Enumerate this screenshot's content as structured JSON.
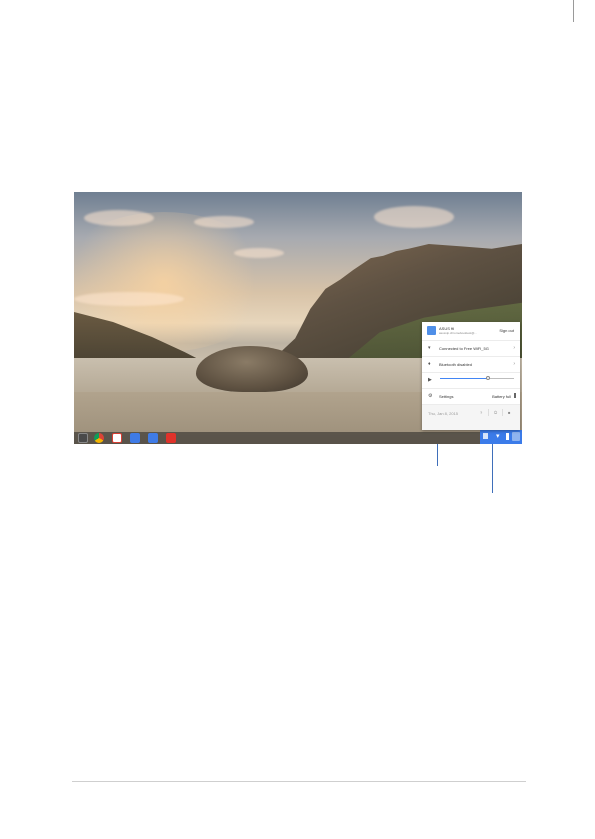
{
  "system_tray": {
    "account_name": "ASUS ftl",
    "account_email": "asusvip.chromebooktest@...",
    "sign_out_label": "Sign out",
    "network_label": "Connected to Free WiFi_5G",
    "bluetooth_label": "Bluetooth disabled",
    "volume_level": 0.65,
    "settings_label": "Settings",
    "battery_label": "Battery full",
    "date_label": "Thu, Jan 8, 2015"
  },
  "shelf": {
    "app_icons": [
      "app-launcher-icon",
      "chrome-icon",
      "gmail-icon",
      "google-search-icon",
      "docs-icon",
      "youtube-icon"
    ],
    "app_colors": [
      "#5a5a5a",
      "#e3a31b",
      "#d93f33",
      "#3f7be6",
      "#3f7be6",
      "#e0322a"
    ]
  },
  "colors": {
    "accent": "#3b7be9",
    "callout": "#3f6fba"
  }
}
